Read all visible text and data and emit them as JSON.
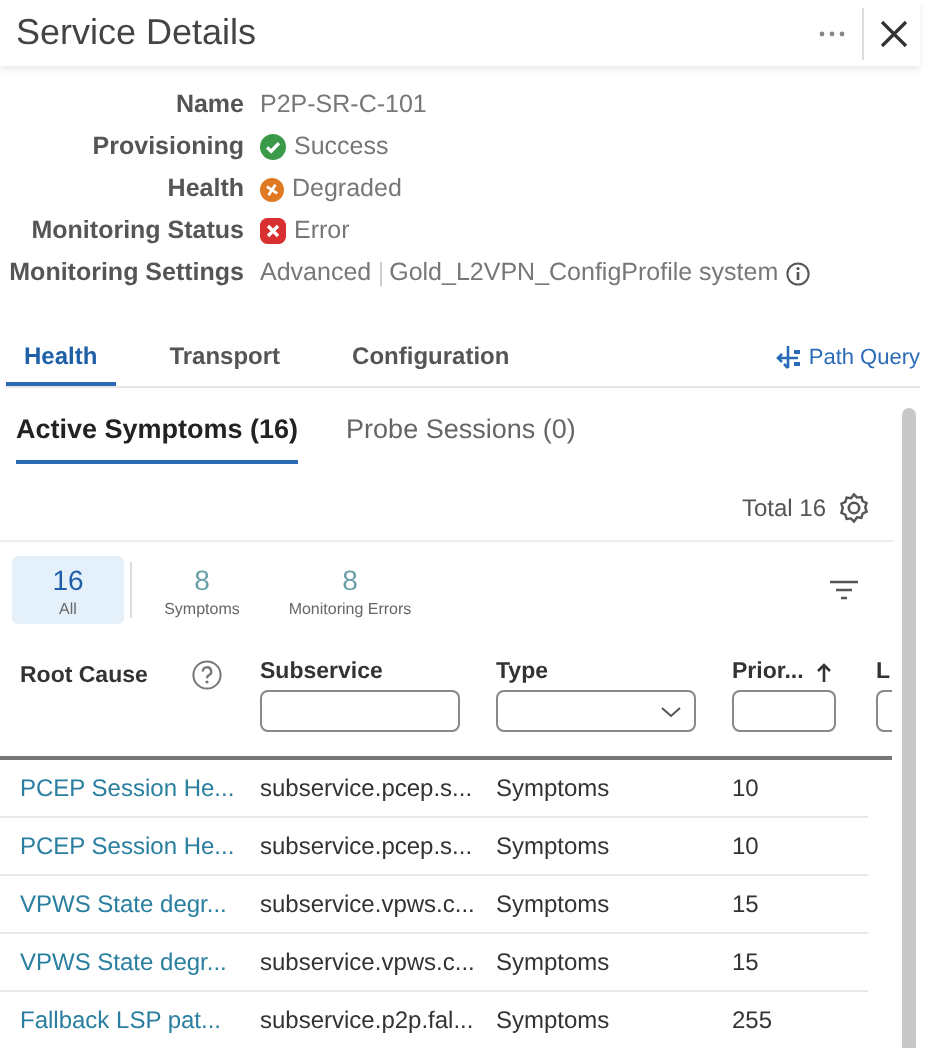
{
  "panel": {
    "title": "Service Details"
  },
  "details": [
    {
      "label": "Name",
      "value": "P2P-SR-C-101",
      "kind": "plain"
    },
    {
      "label": "Provisioning",
      "value": "Success",
      "kind": "success"
    },
    {
      "label": "Health",
      "value": "Degraded",
      "kind": "degraded"
    },
    {
      "label": "Monitoring Status",
      "value": "Error",
      "kind": "error"
    },
    {
      "label": "Monitoring Settings",
      "value": "Advanced",
      "extra": "Gold_L2VPN_ConfigProfile system",
      "kind": "plain"
    }
  ],
  "tabs": [
    {
      "label": "Health",
      "selected": true
    },
    {
      "label": "Transport",
      "selected": false
    },
    {
      "label": "Configuration",
      "selected": false
    }
  ],
  "path_query": "Path Query",
  "subtabs": [
    {
      "label": "Active Symptoms (16)",
      "selected": true
    },
    {
      "label": "Probe Sessions (0)",
      "selected": false
    }
  ],
  "total": "Total 16",
  "filters": [
    {
      "count": "16",
      "label": "All",
      "selected": true
    },
    {
      "count": "8",
      "label": "Symptoms",
      "selected": false
    },
    {
      "count": "8",
      "label": "Monitoring Errors",
      "selected": false
    }
  ],
  "table": {
    "columns": [
      {
        "label": "Root Cause",
        "kind": "plain",
        "help": true,
        "sorted": false
      },
      {
        "label": "Subservice",
        "kind": "text",
        "help": false,
        "sorted": false
      },
      {
        "label": "Type",
        "kind": "select",
        "help": false,
        "sorted": false
      },
      {
        "label": "Prior...",
        "kind": "text",
        "help": false,
        "sorted": true
      },
      {
        "label": "L",
        "kind": "text",
        "help": false,
        "sorted": false
      }
    ],
    "rows": [
      [
        "PCEP Session He...",
        "subservice.pcep.s...",
        "Symptoms",
        "10"
      ],
      [
        "PCEP Session He...",
        "subservice.pcep.s...",
        "Symptoms",
        "10"
      ],
      [
        "VPWS State degr...",
        "subservice.vpws.c...",
        "Symptoms",
        "15"
      ],
      [
        "VPWS State degr...",
        "subservice.vpws.c...",
        "Symptoms",
        "15"
      ],
      [
        "Fallback LSP pat...",
        "subservice.p2p.fal...",
        "Symptoms",
        "255"
      ]
    ]
  }
}
